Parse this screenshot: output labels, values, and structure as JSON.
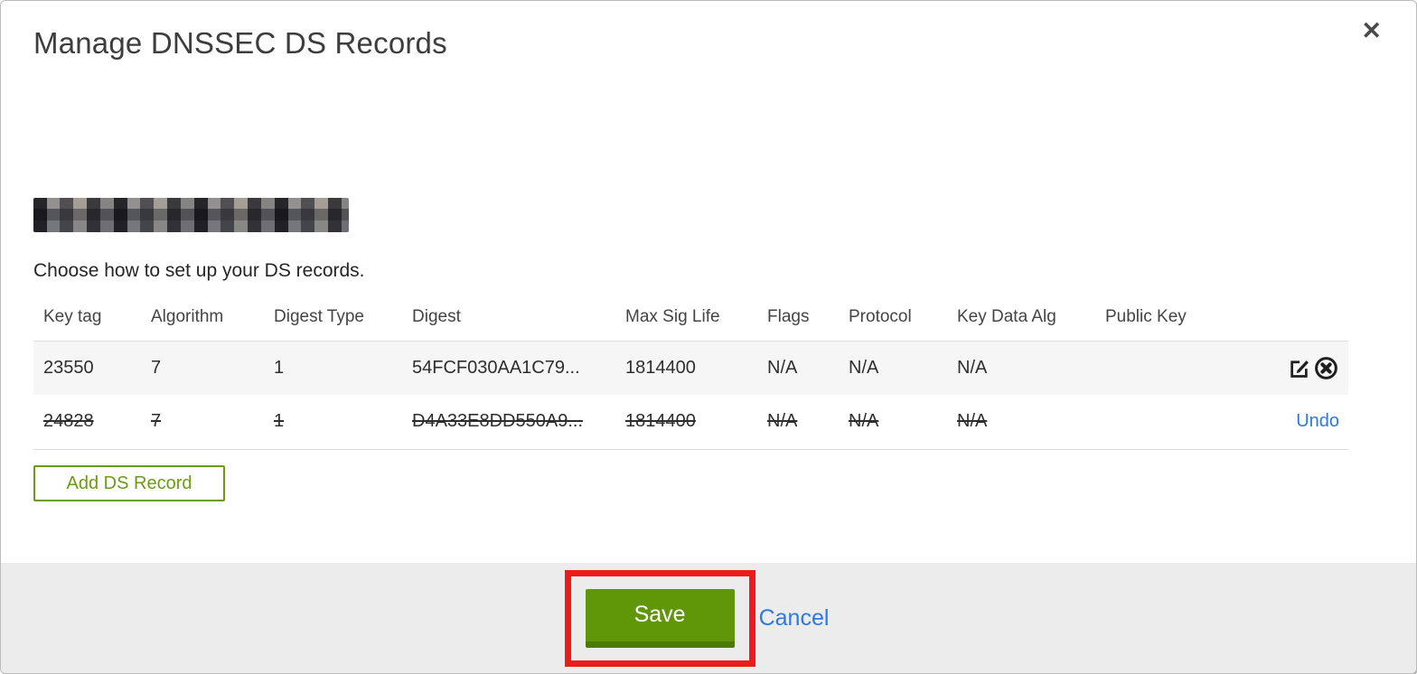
{
  "dialog": {
    "title": "Manage DNSSEC DS Records",
    "close_glyph": "✕",
    "instruction": "Choose how to set up your DS records.",
    "domain_redacted": true
  },
  "table": {
    "columns": {
      "key_tag": "Key tag",
      "algorithm": "Algorithm",
      "digest_type": "Digest Type",
      "digest": "Digest",
      "max_sig_life": "Max Sig Life",
      "flags": "Flags",
      "protocol": "Protocol",
      "key_data_alg": "Key Data Alg",
      "public_key": "Public Key"
    },
    "rows": [
      {
        "key_tag": "23550",
        "algorithm": "7",
        "digest_type": "1",
        "digest": "54FCF030AA1C79...",
        "max_sig_life": "1814400",
        "flags": "N/A",
        "protocol": "N/A",
        "key_data_alg": "N/A",
        "public_key": "",
        "state": "normal"
      },
      {
        "key_tag": "24828",
        "algorithm": "7",
        "digest_type": "1",
        "digest": "D4A33E8DD550A9...",
        "max_sig_life": "1814400",
        "flags": "N/A",
        "protocol": "N/A",
        "key_data_alg": "N/A",
        "public_key": "",
        "state": "deleted",
        "undo_label": "Undo"
      }
    ]
  },
  "buttons": {
    "add_ds_record": "Add DS Record",
    "save": "Save",
    "cancel": "Cancel"
  },
  "icons": {
    "edit": "edit-square-pencil-icon",
    "delete": "circle-x-icon",
    "close": "close-x-icon"
  },
  "colors": {
    "button_green": "#5f9708",
    "button_green_shadow": "#4b7a06",
    "outline_green": "#6a9c13",
    "link_blue": "#2d78e8",
    "annotation_red": "#ed1c1c",
    "row_alt_bg": "#f6f6f6",
    "footer_bg": "#ececec"
  }
}
